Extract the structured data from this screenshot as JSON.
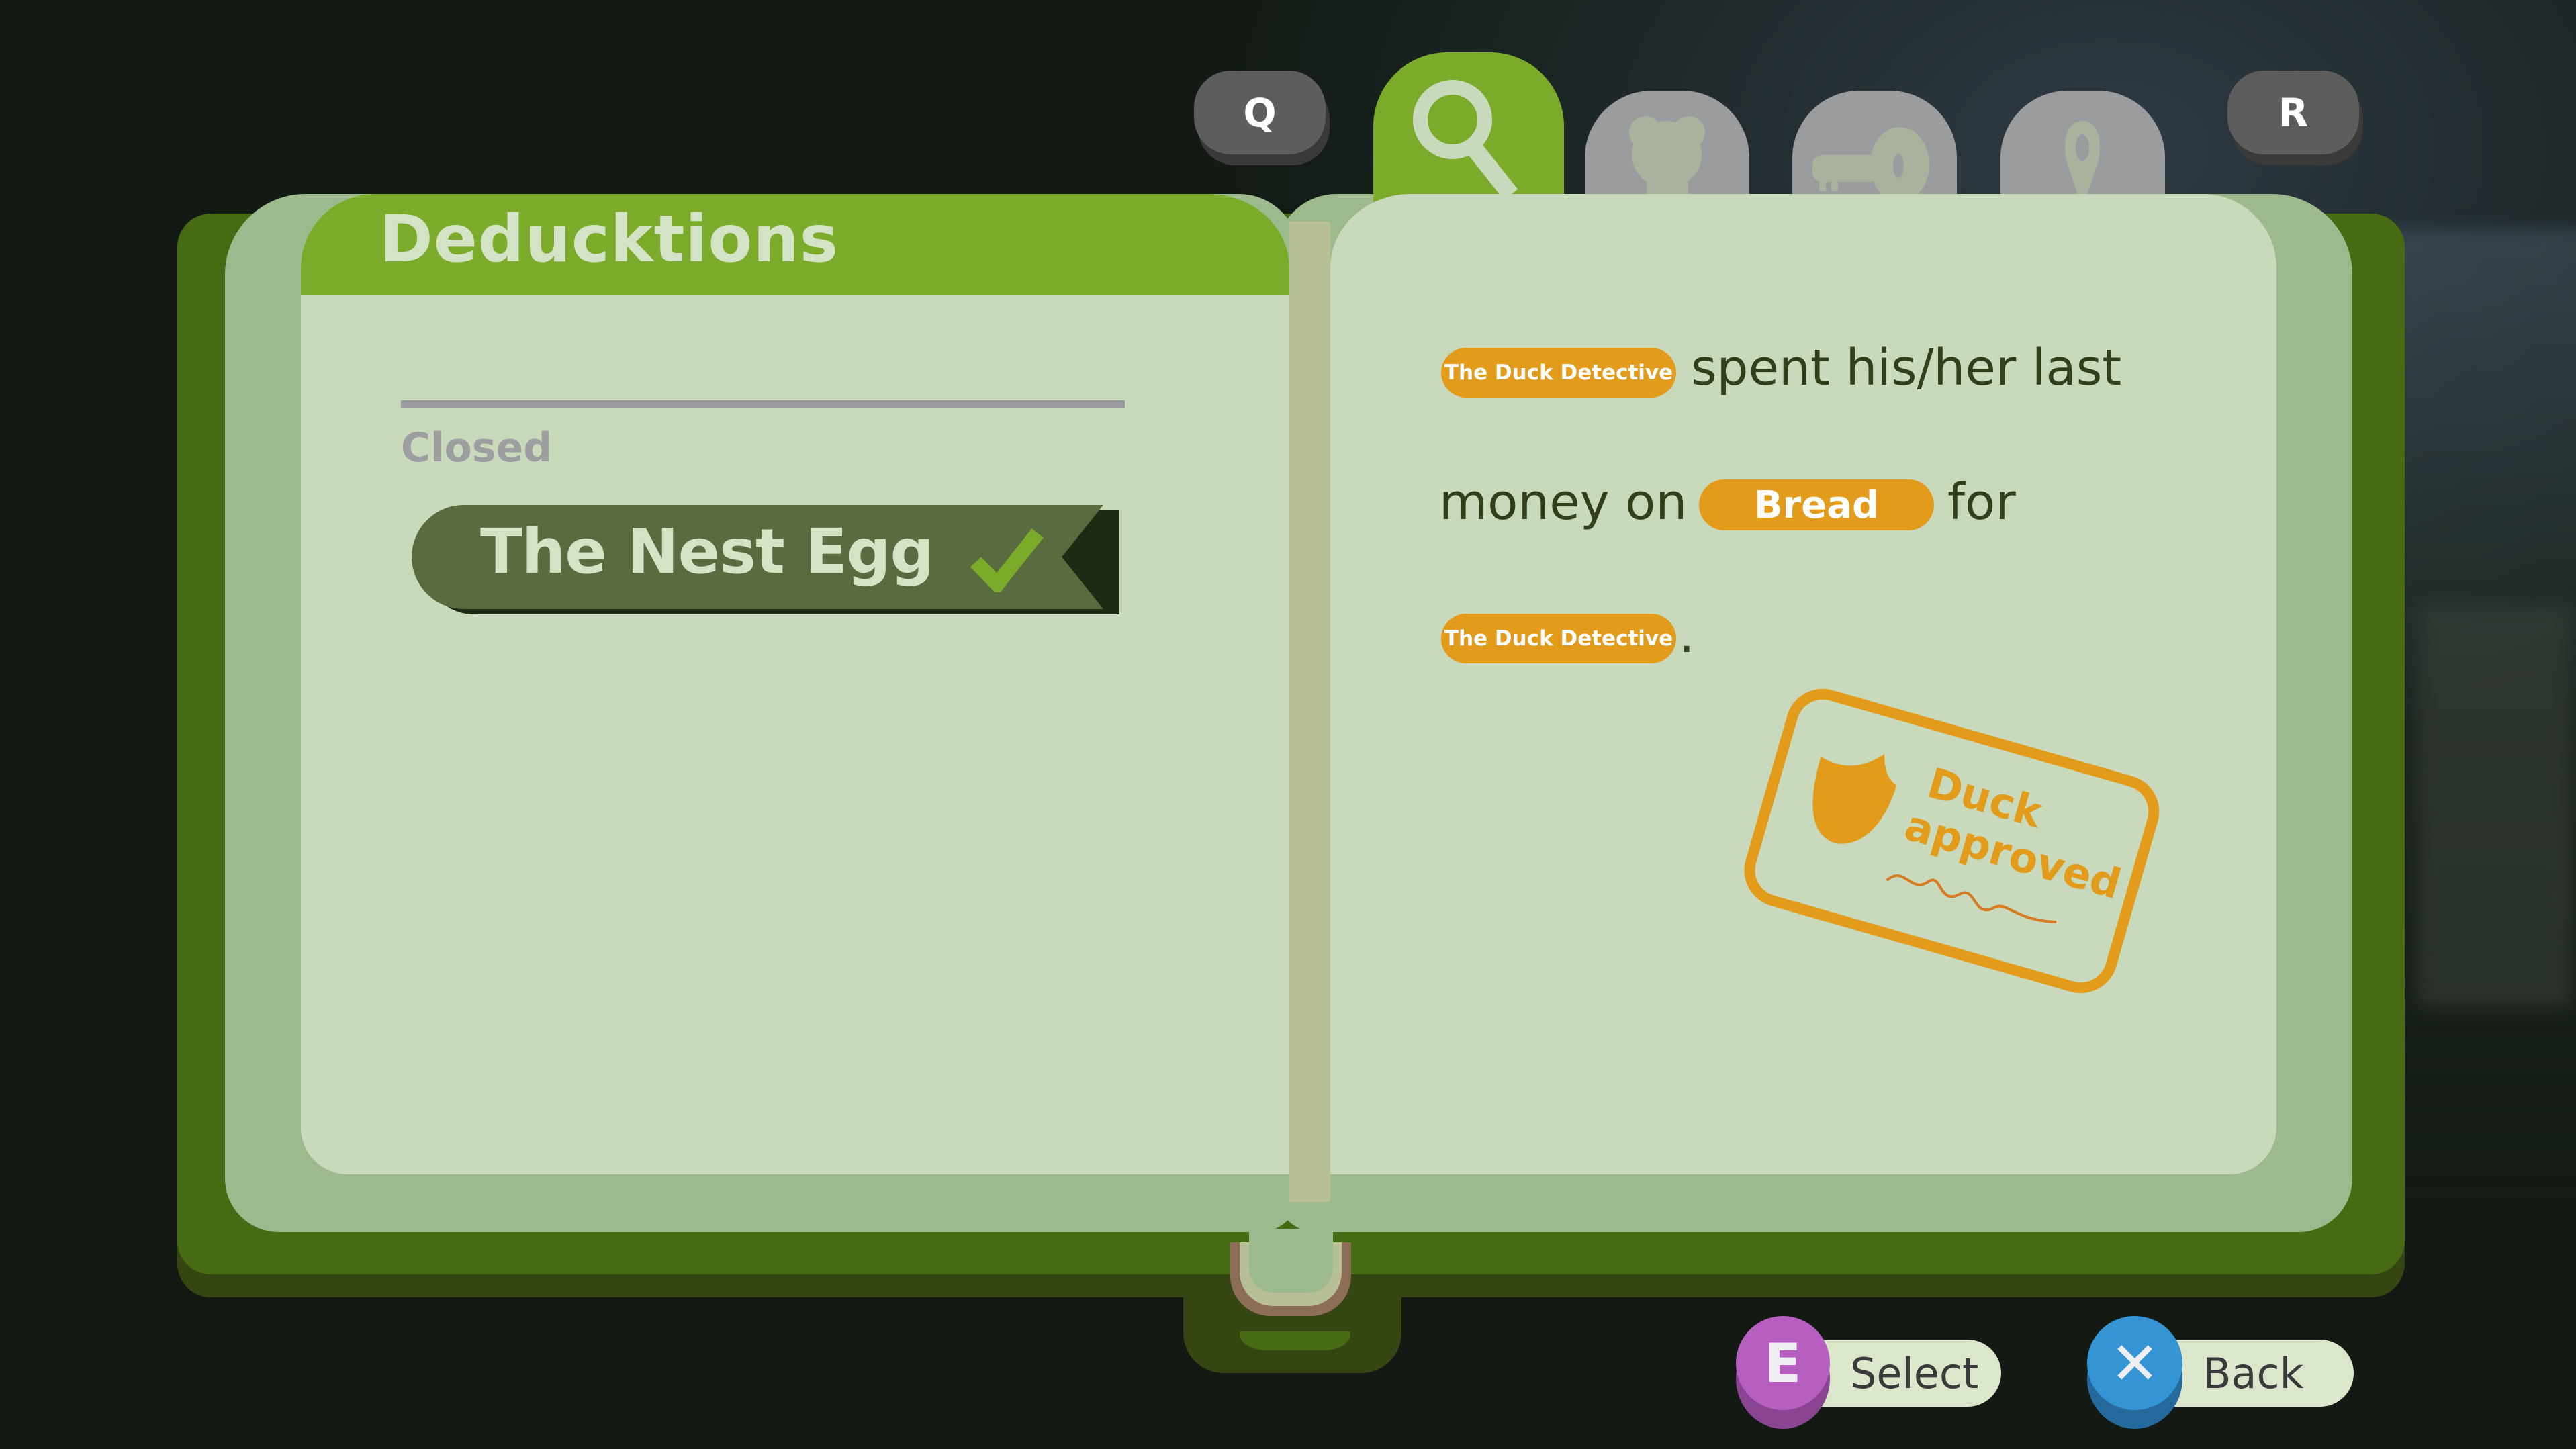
{
  "tabs": {
    "prev_key": "Q",
    "next_key": "R",
    "items": [
      {
        "icon": "magnifier-icon",
        "active": true
      },
      {
        "icon": "bear-icon",
        "active": false
      },
      {
        "icon": "key-icon",
        "active": false
      },
      {
        "icon": "location-pin-icon",
        "active": false
      }
    ]
  },
  "left_page": {
    "title": "Deducktions",
    "section_label": "Closed",
    "cases": [
      {
        "label": "The Nest Egg",
        "status": "solved"
      }
    ]
  },
  "right_page": {
    "sentence": {
      "slot1": "The Duck Detective",
      "text1": "spent his/her last",
      "text2": "money on",
      "slot2": "Bread",
      "text3": "for",
      "slot3": "The Duck Detective",
      "text4": "."
    },
    "stamp": {
      "line1": "Duck",
      "line2": "approved"
    }
  },
  "prompts": {
    "select": {
      "key": "E",
      "label": "Select"
    },
    "back": {
      "key": "✕",
      "label": "Back"
    }
  },
  "colors": {
    "accent_green": "#7bab2a",
    "pill_orange": "#e29b1a",
    "page": "#c8dabb",
    "select_key": "#b65fc0",
    "back_key": "#3594d4"
  }
}
